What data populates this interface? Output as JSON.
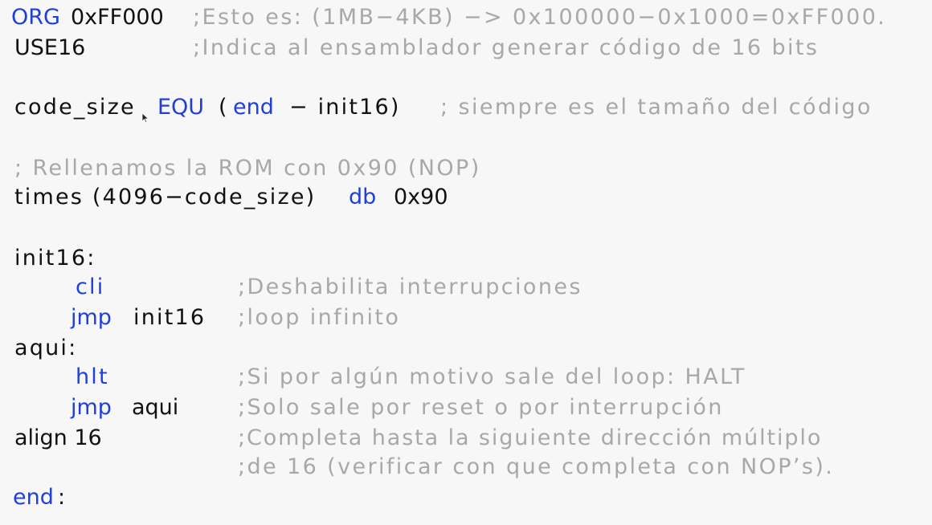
{
  "code": {
    "l1": {
      "kw": "ORG",
      "val": "0xFF000",
      "comment": ";Esto es: (1MB−4KB) −> 0x100000−0x1000=0xFF000."
    },
    "l2": {
      "val": "USE16",
      "comment": ";Indica al ensamblador generar código de 16 bits"
    },
    "l3": {
      "name": "code_size",
      "kw": "EQU",
      "paren_open": "(",
      "kw2": "end",
      "rest": "− init16)",
      "comment": "; siempre es el tamaño del código"
    },
    "l4": {
      "comment": "; Rellenamos la ROM con 0x90 (NOP)"
    },
    "l5": {
      "pre": "times (4096−code_size)",
      "kw": "db",
      "val": "0x90"
    },
    "l6": {
      "label": "init16:"
    },
    "l7": {
      "kw": "cli",
      "comment": ";Deshabilita interrupciones"
    },
    "l8": {
      "kw": "jmp",
      "val": "init16",
      "comment": ";loop infinito"
    },
    "l9": {
      "label": "aqui:"
    },
    "l10": {
      "kw": "hlt",
      "comment": ";Si por algún motivo sale del loop: HALT"
    },
    "l11": {
      "kw": "jmp",
      "val": "aqui",
      "comment": ";Solo sale por reset o por interrupción"
    },
    "l12": {
      "val": "align 16",
      "comment": ";Completa hasta la siguiente dirección múltiplo"
    },
    "l13": {
      "comment": ";de 16 (verificar con que completa con NOP’s)."
    },
    "l14": {
      "kw": "end",
      "colon": ":"
    }
  },
  "colors": {
    "keyword": "#1f3fd6",
    "text": "#111111",
    "comment": "#a8a8a8",
    "background": "#f7f7f7"
  },
  "icons": {
    "cursor": "mouse-pointer-icon"
  }
}
